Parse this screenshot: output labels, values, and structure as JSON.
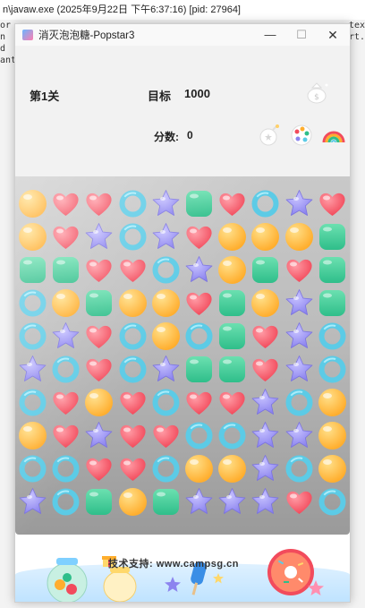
{
  "console": {
    "title": "n\\javaw.exe  (2025年9月22日 下午6:37:16) [pid: 27964]",
    "left_fragments": [
      "or",
      "n d",
      "ant"
    ],
    "right_fragments": [
      "tex",
      "",
      "rt."
    ]
  },
  "window": {
    "title": "消灭泡泡糖-Popstar3",
    "controls": {
      "minimize": "—",
      "maximize": "☐",
      "close": "✕"
    }
  },
  "hud": {
    "level": "第1关",
    "target_label": "目标",
    "target_value": "1000",
    "score_label": "分数:",
    "score_value": "0",
    "tools": [
      "money-bag-icon",
      "bomb-icon",
      "palette-icon",
      "rainbow-icon"
    ]
  },
  "footer": {
    "support_text": "技术支持: www.campsg.cn"
  },
  "colors": {
    "orange": "#ffae2e",
    "red": "#f24b5c",
    "purple": "#8c84ef",
    "cyan": "#5ccbe6",
    "green": "#2fbe8a"
  },
  "board": {
    "legend": {
      "O": "orange-ball",
      "H": "red-heart",
      "S": "purple-star",
      "R": "cyan-ring",
      "G": "green-square"
    },
    "rows": [
      [
        "O",
        "H",
        "H",
        "R",
        "S",
        "G",
        "H",
        "R",
        "S",
        "H"
      ],
      [
        "O",
        "H",
        "S",
        "R",
        "S",
        "H",
        "O",
        "O",
        "O",
        "G"
      ],
      [
        "G",
        "G",
        "H",
        "H",
        "R",
        "S",
        "O",
        "G",
        "H",
        "G"
      ],
      [
        "R",
        "O",
        "G",
        "O",
        "O",
        "H",
        "G",
        "O",
        "S",
        "G"
      ],
      [
        "R",
        "S",
        "H",
        "R",
        "O",
        "R",
        "G",
        "H",
        "S",
        "R"
      ],
      [
        "S",
        "R",
        "H",
        "R",
        "S",
        "G",
        "G",
        "H",
        "S",
        "R"
      ],
      [
        "R",
        "H",
        "O",
        "H",
        "R",
        "H",
        "H",
        "S",
        "R",
        "O"
      ],
      [
        "O",
        "H",
        "S",
        "H",
        "H",
        "R",
        "R",
        "S",
        "S",
        "O"
      ],
      [
        "R",
        "R",
        "H",
        "H",
        "R",
        "O",
        "O",
        "S",
        "R",
        "O"
      ],
      [
        "S",
        "R",
        "G",
        "O",
        "G",
        "S",
        "S",
        "S",
        "H",
        "R"
      ]
    ]
  }
}
